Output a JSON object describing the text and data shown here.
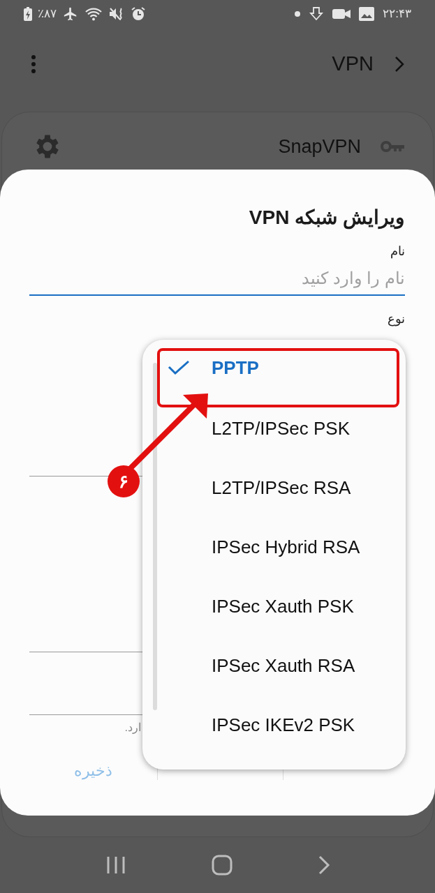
{
  "status_bar": {
    "battery": "٪۸۷",
    "time": "۲۲:۴۳"
  },
  "app_bar": {
    "title": "VPN"
  },
  "vpn_list": [
    {
      "name": "SnapVPN"
    }
  ],
  "dialog": {
    "title": "ویرایش شبکه VPN",
    "name_label": "نام",
    "name_placeholder": "نام را وارد کنید",
    "type_label": "نوع",
    "hint": "ارد.",
    "buttons": [
      {
        "label": "ذخیره",
        "disabled": true
      }
    ]
  },
  "dropdown": {
    "options": [
      {
        "label": "PPTP",
        "selected": true
      },
      {
        "label": "L2TP/IPSec PSK",
        "selected": false
      },
      {
        "label": "L2TP/IPSec RSA",
        "selected": false
      },
      {
        "label": "IPSec Hybrid RSA",
        "selected": false
      },
      {
        "label": "IPSec Xauth PSK",
        "selected": false
      },
      {
        "label": "IPSec Xauth RSA",
        "selected": false
      },
      {
        "label": "IPSec IKEv2 PSK",
        "selected": false
      }
    ]
  },
  "annotation": {
    "badge": "۶"
  }
}
